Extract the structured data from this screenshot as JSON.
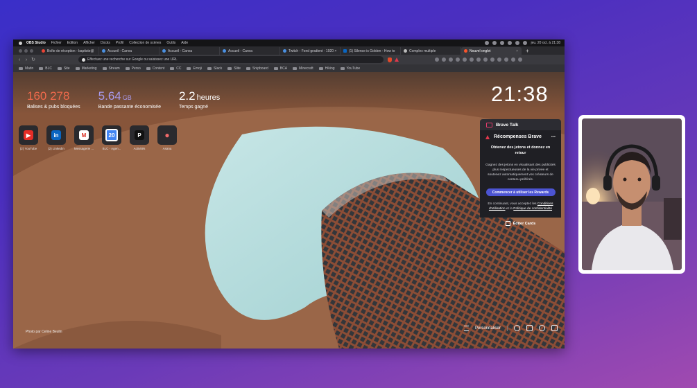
{
  "menubar": {
    "app_name": "OBS Studio",
    "items": [
      "Fichier",
      "Edition",
      "Afficher",
      "Docks",
      "Profil",
      "Collection de scènes",
      "Outils",
      "Aide"
    ],
    "datetime": "jeu. 20 oct. à 21:38"
  },
  "tabs": [
    {
      "title": "Boîte de réception - baptiste@",
      "icon": "gmail-icon"
    },
    {
      "title": "Accueil - Canva",
      "icon": "canva-icon"
    },
    {
      "title": "Accueil - Canva",
      "icon": "canva-icon"
    },
    {
      "title": "Accueil - Canva",
      "icon": "canva-icon"
    },
    {
      "title": "Twitch - Fond gradient - 1920 ×",
      "icon": "twitch-icon"
    },
    {
      "title": "(1) Silence is Golden - How to",
      "icon": "linkedin-icon"
    },
    {
      "title": "Complex multiple",
      "icon": "web-icon"
    },
    {
      "title": "Nouvel onglet",
      "icon": "brave-icon"
    }
  ],
  "toolbar": {
    "url_placeholder": "Effectuez une recherche sur Google ou saisissez une URL"
  },
  "bookmarks": [
    "Matin",
    "BLC",
    "Site",
    "Marketing",
    "Stream",
    "Perso",
    "Content",
    "CC",
    "Emoji",
    "Slack",
    "Slite",
    "Snipboard",
    "BCA",
    "Minecraft",
    "Hiking",
    "YouTube"
  ],
  "stats": [
    {
      "value": "160 278",
      "unit": "",
      "label": "Balises & pubs bloquées",
      "color": "#f16a4c"
    },
    {
      "value": "5.64",
      "unit": "GB",
      "label": "Bande passante économisée",
      "color": "#a89bf0"
    },
    {
      "value": "2.2",
      "unit": "heures",
      "label": "Temps gagné",
      "color": "#ffffff"
    }
  ],
  "clock": "21:38",
  "tiles": [
    {
      "label": "(2) YouTube",
      "glyph": "▶",
      "bg": "#e52d27",
      "fg": "#ffffff"
    },
    {
      "label": "(2) LinkedIn",
      "glyph": "in",
      "bg": "#0a66c2",
      "fg": "#ffffff"
    },
    {
      "label": "Messagerie ...",
      "glyph": "M",
      "bg": "#ffffff",
      "fg": "#d93025"
    },
    {
      "label": "BLC - Agen...",
      "glyph": "20",
      "bg": "#4285f4",
      "fg": "#ffffff"
    },
    {
      "label": "Activités",
      "glyph": "P",
      "bg": "#111111",
      "fg": "#ffffff"
    },
    {
      "label": "Asana",
      "glyph": "●",
      "bg": "#2a2a2e",
      "fg": "#f06a6a"
    }
  ],
  "widget": {
    "talk_title": "Brave Talk",
    "rewards_title": "Récompenses Brave",
    "headline": "Obtenez des jetons et donnez en retour",
    "description": "Gagnez des jetons en visualisant des publicités plus respectueuses de la vie privée et soutenez automatiquement vos créateurs de contenu préférés.",
    "button": "Commencer à utiliser les Rewards",
    "terms_prefix": "En continuant, vous acceptez les",
    "terms_link": "Conditions d'utilisation",
    "terms_and": "et la",
    "privacy_link": "Politique de confidentialité",
    "edit_cards": "Éditer Cards"
  },
  "photo_credit": "Photo par Celine Beulin",
  "customize": "Personnaliser",
  "colors": {
    "brave_orange": "#fb542b",
    "rewards_button": "#4c54d2"
  }
}
